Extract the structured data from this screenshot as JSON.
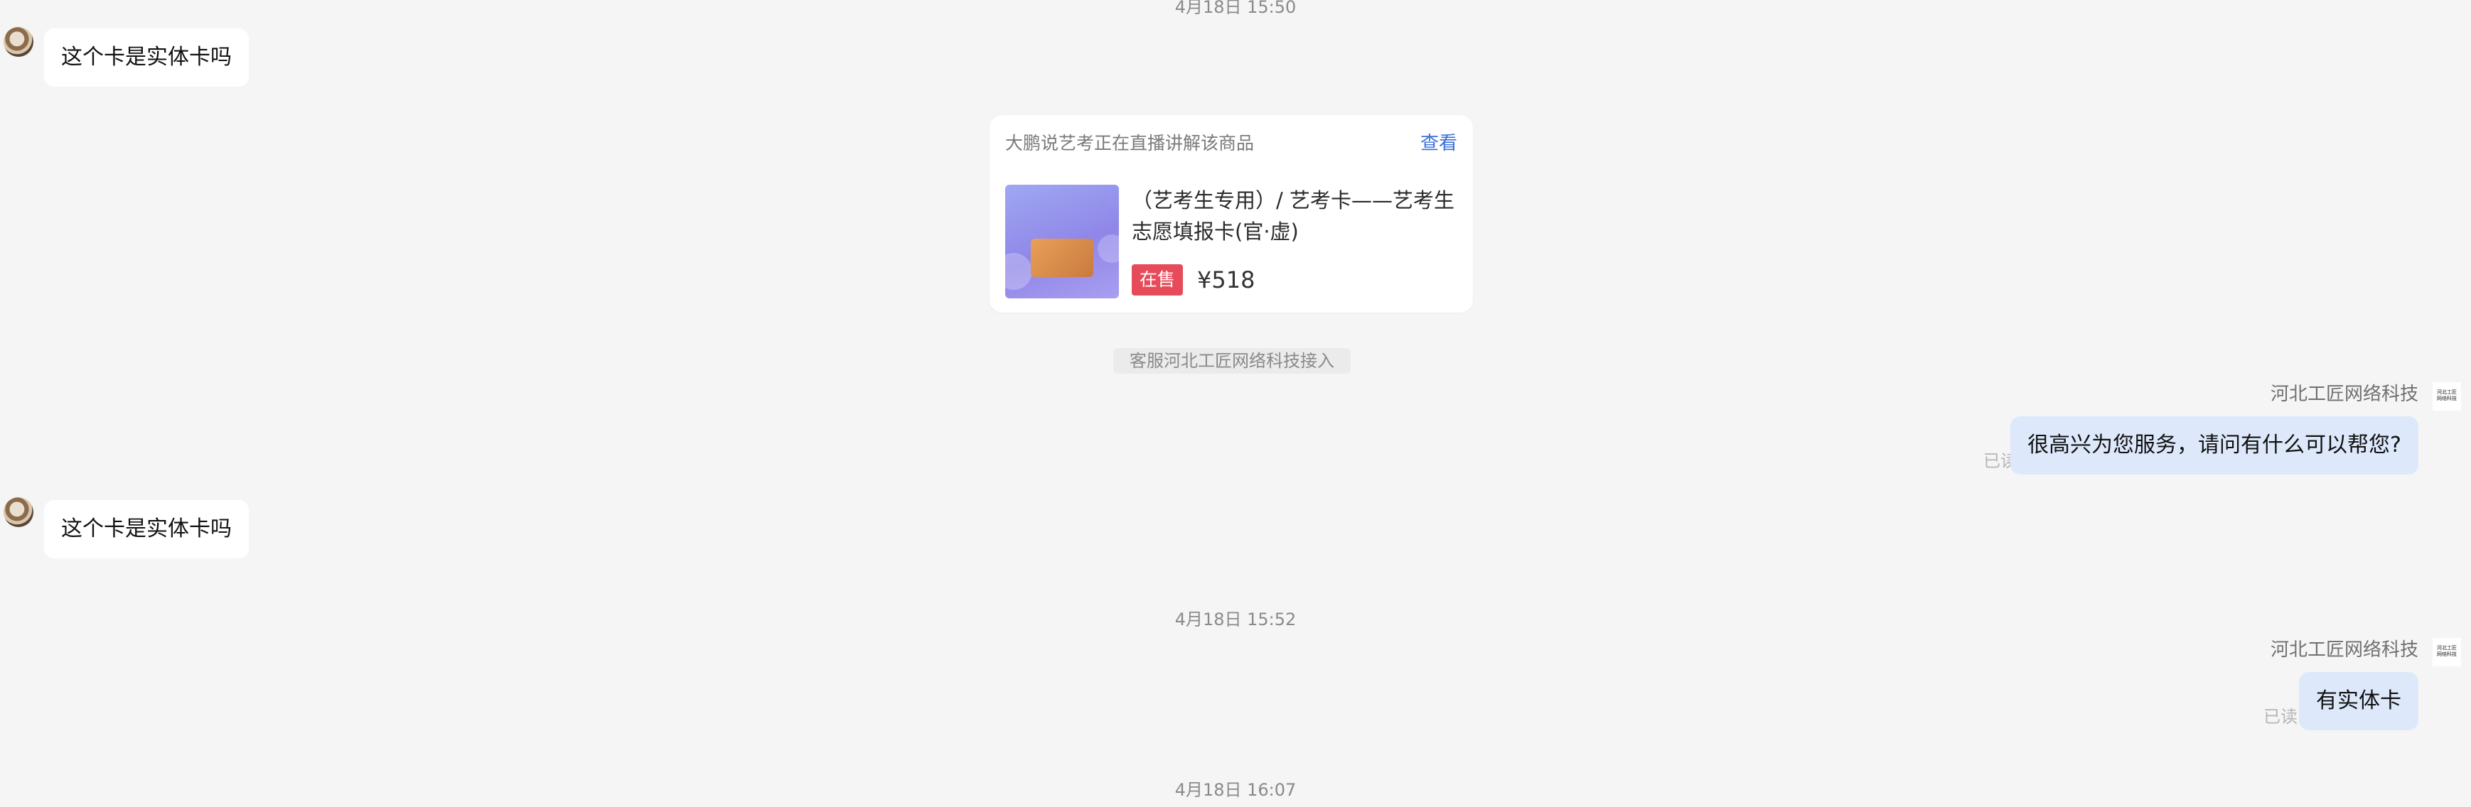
{
  "messages": {
    "timestamp_1": "4月18日 15:50",
    "incoming_1": "这个卡是实体卡吗",
    "product": {
      "header": "大鹏说艺考正在直播讲解该商品",
      "view_label": "查看",
      "title": "（艺考生专用）/ 艺考卡——艺考生志愿填报卡(官·虚)",
      "status_badge": "在售",
      "price": "¥518",
      "thumbnail_icon": "product-thumbnail-image",
      "accent_color": "#e64b5a"
    },
    "system_notice": "客服河北工匠网络科技接入",
    "sender_name_1": "河北工匠网络科技",
    "outgoing_1": "很高兴为您服务，请问有什么可以帮您?",
    "read_1": "已读",
    "incoming_2": "这个卡是实体卡吗",
    "timestamp_2": "4月18日 15:52",
    "sender_name_2": "河北工匠网络科技",
    "outgoing_2": "有实体卡",
    "read_2": "已读",
    "timestamp_3": "4月18日 16:07"
  }
}
